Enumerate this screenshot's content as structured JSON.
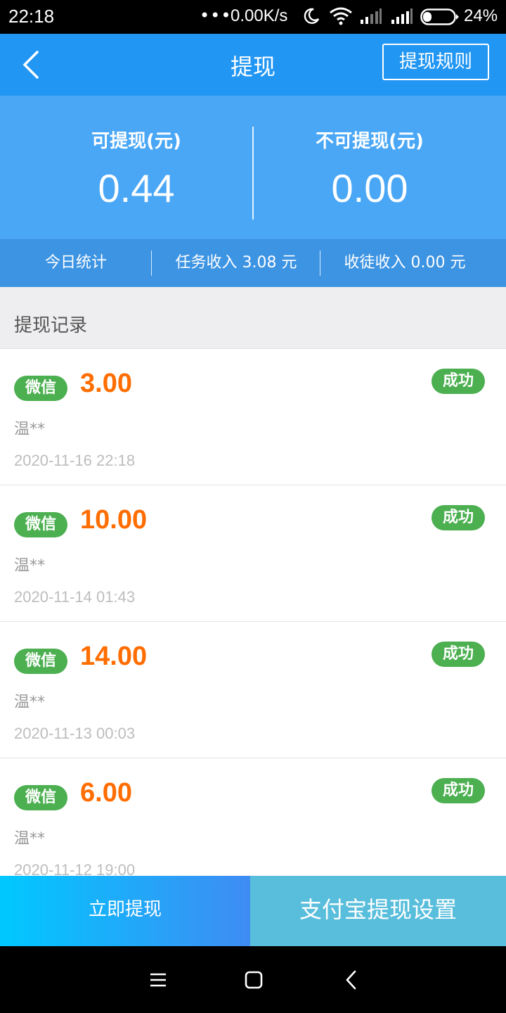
{
  "status_bar": {
    "time": "22:18",
    "dots": "•••",
    "net_speed": "0.00K/s",
    "battery": "24%",
    "icons": [
      "moon-icon",
      "wifi-icon",
      "signal-icon",
      "signal-icon",
      "battery-icon"
    ]
  },
  "header": {
    "title": "提现",
    "rules_button": "提现规则"
  },
  "summary": {
    "available_label": "可提现(元)",
    "available_value": "0.44",
    "unavailable_label": "不可提现(元)",
    "unavailable_value": "0.00"
  },
  "today": {
    "label": "今日统计",
    "task_income": "任务收入 3.08 元",
    "apprentice_income": "收徒收入 0.00 元"
  },
  "records": {
    "title": "提现记录",
    "items": [
      {
        "method": "微信",
        "amount": "3.00",
        "status": "成功",
        "name": "温**",
        "time": "2020-11-16 22:18"
      },
      {
        "method": "微信",
        "amount": "10.00",
        "status": "成功",
        "name": "温**",
        "time": "2020-11-14 01:43"
      },
      {
        "method": "微信",
        "amount": "14.00",
        "status": "成功",
        "name": "温**",
        "time": "2020-11-13 00:03"
      },
      {
        "method": "微信",
        "amount": "6.00",
        "status": "成功",
        "name": "温**",
        "time": "2020-11-12 19:00"
      }
    ]
  },
  "bottom": {
    "withdraw_button": "立即提现",
    "alipay_button": "支付宝提现设置"
  },
  "colors": {
    "title_bar": "#2196f3",
    "summary_bg": "#4aa7f6",
    "amount": "#ff6d00",
    "badge_green": "#4caf50",
    "alipay_button": "#59bedc"
  }
}
